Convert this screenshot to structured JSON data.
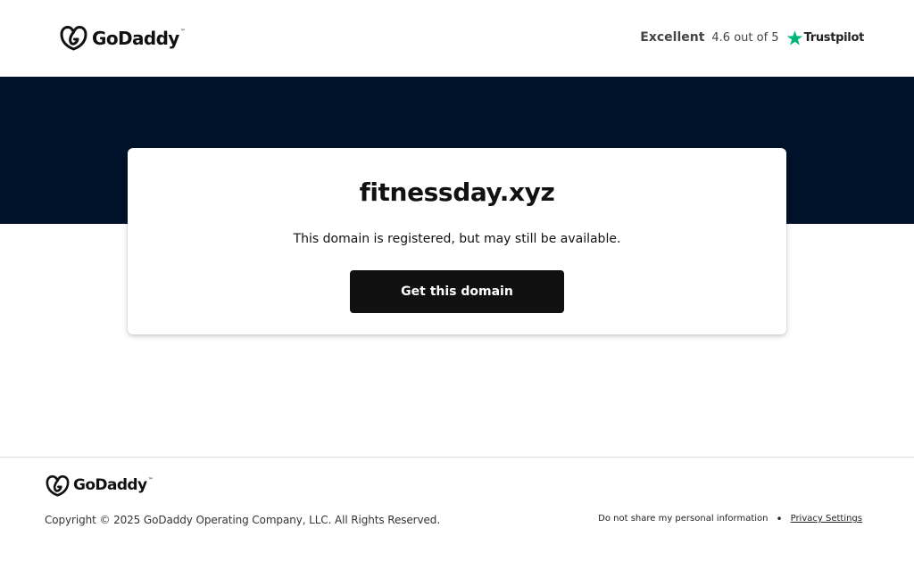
{
  "header": {
    "logo_text": "GoDaddy",
    "logo_tm": "™",
    "rating": {
      "label": "Excellent",
      "score_text": "4.6 out of 5",
      "provider": "Trustpilot"
    }
  },
  "main": {
    "domain": "fitnessday.xyz",
    "status": "This domain is registered, but may still be available.",
    "cta_label": "Get this domain"
  },
  "footer": {
    "logo_text": "GoDaddy",
    "logo_tm": "™",
    "copyright": "Copyright © 2025 GoDaddy Operating Company, LLC. All Rights Reserved.",
    "links": [
      {
        "label": "Do not share my personal information"
      },
      {
        "label": "Privacy Settings"
      }
    ],
    "separator": "•"
  },
  "icons": {
    "logo": "godaddy-heart-icon",
    "rating": "trustpilot-star-icon"
  },
  "colors": {
    "hero_background": "#00132b",
    "button_background": "#111111",
    "button_text": "#ffffff",
    "trustpilot_green": "#00b67a"
  }
}
